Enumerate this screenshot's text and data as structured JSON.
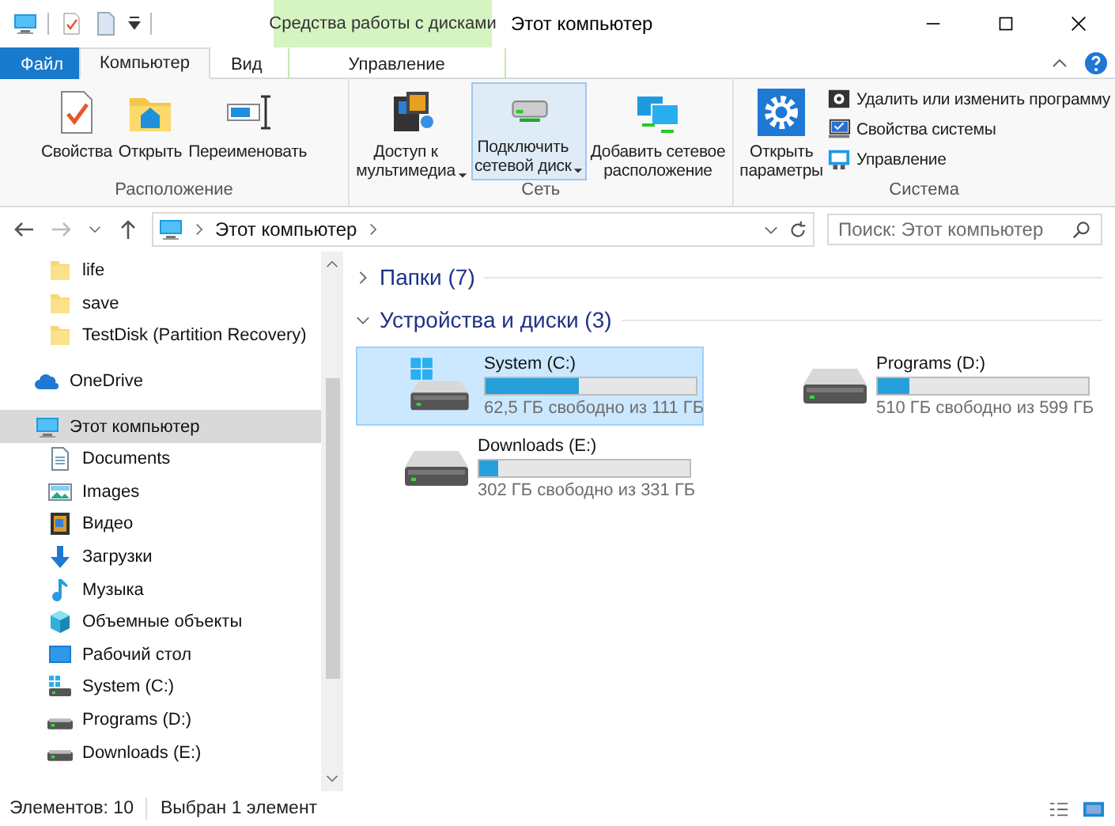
{
  "window": {
    "title": "Этот компьютер"
  },
  "context_tab_group": {
    "label": "Средства работы с дисками"
  },
  "ribbon_tabs": [
    {
      "label": "Файл",
      "kind": "file",
      "selected": false
    },
    {
      "label": "Компьютер",
      "kind": "tab",
      "selected": true
    },
    {
      "label": "Вид",
      "kind": "tab",
      "selected": false
    },
    {
      "label": "Управление",
      "kind": "context",
      "selected": false
    }
  ],
  "ribbon_groups": [
    {
      "name": "Расположение",
      "buttons": [
        {
          "label": "Свойства",
          "kind": "properties",
          "dropdown": false,
          "selected": false
        },
        {
          "label": "Открыть",
          "kind": "open",
          "dropdown": false,
          "selected": false
        },
        {
          "label": "Переименовать",
          "kind": "rename",
          "dropdown": false,
          "selected": false
        }
      ]
    },
    {
      "name": "Сеть",
      "buttons": [
        {
          "label": "Доступ к\nмультимедиа",
          "kind": "media",
          "dropdown": true,
          "selected": false
        },
        {
          "label": "Подключить\nсетевой диск",
          "kind": "map-drive",
          "dropdown": true,
          "selected": true
        },
        {
          "label": "Добавить сетевое\nрасположение",
          "kind": "add-location",
          "dropdown": false,
          "selected": false
        }
      ]
    },
    {
      "name": "Система",
      "buttons": [
        {
          "label": "Открыть\nпараметры",
          "kind": "settings",
          "dropdown": false,
          "selected": false
        }
      ],
      "small_buttons": [
        {
          "label": "Удалить или изменить программу",
          "kind": "uninstall"
        },
        {
          "label": "Свойства системы",
          "kind": "system-props"
        },
        {
          "label": "Управление",
          "kind": "manage"
        }
      ]
    }
  ],
  "address_bar": {
    "path": [
      "Этот компьютер"
    ]
  },
  "search": {
    "placeholder": "Поиск: Этот компьютер"
  },
  "nav_pane": {
    "partial_items": [
      {
        "label": "life",
        "kind": "folder",
        "selected": false
      },
      {
        "label": "save",
        "kind": "folder",
        "selected": false
      },
      {
        "label": "TestDisk (Partition Recovery)",
        "kind": "folder",
        "selected": false
      }
    ],
    "items": [
      {
        "label": "OneDrive",
        "kind": "cloud",
        "selected": false
      },
      {
        "label": "Этот компьютер",
        "kind": "pc",
        "selected": true,
        "children": [
          {
            "label": "Documents",
            "kind": "documents",
            "selected": false
          },
          {
            "label": "Images",
            "kind": "images",
            "selected": false
          },
          {
            "label": "Видео",
            "kind": "video",
            "selected": false
          },
          {
            "label": "Загрузки",
            "kind": "downloads",
            "selected": false
          },
          {
            "label": "Музыка",
            "kind": "music",
            "selected": false
          },
          {
            "label": "Объемные объекты",
            "kind": "objects3d",
            "selected": false
          },
          {
            "label": "Рабочий стол",
            "kind": "desktop",
            "selected": false
          },
          {
            "label": "System (C:)",
            "kind": "drive-win",
            "selected": false
          },
          {
            "label": "Programs (D:)",
            "kind": "drive",
            "selected": false
          },
          {
            "label": "Downloads (E:)",
            "kind": "drive",
            "selected": false
          }
        ]
      }
    ]
  },
  "content_groups": [
    {
      "title": "Папки (7)",
      "expanded": false
    },
    {
      "title": "Устройства и диски (3)",
      "expanded": true,
      "drives": [
        {
          "name": "System (C:)",
          "free": "62,5 ГБ свободно из 111 ГБ",
          "level": 0.44,
          "kind": "drive-win",
          "selected": true
        },
        {
          "name": "Programs (D:)",
          "free": "510 ГБ свободно из 599 ГБ",
          "level": 0.15,
          "kind": "drive",
          "selected": false
        },
        {
          "name": "Downloads (E:)",
          "free": "302 ГБ свободно из 331 ГБ",
          "level": 0.09,
          "kind": "drive",
          "selected": false
        }
      ]
    }
  ],
  "status_bar": {
    "count": "Элементов: 10",
    "selection": "Выбран 1 элемент"
  }
}
